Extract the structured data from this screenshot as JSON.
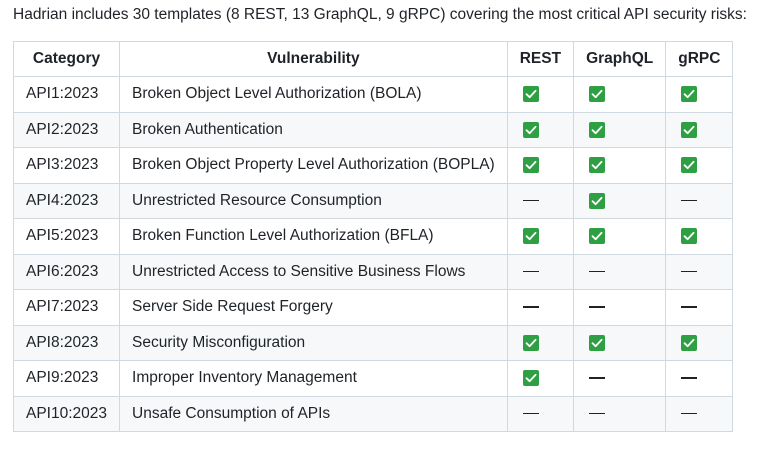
{
  "intro_text": "Hadrian includes 30 templates (8 REST, 13 GraphQL, 9 gRPC) covering the most critical API security risks:",
  "table": {
    "headers": [
      "Category",
      "Vulnerability",
      "REST",
      "GraphQL",
      "gRPC"
    ],
    "rows": [
      {
        "category": "API1:2023",
        "vulnerability": "Broken Object Level Authorization (BOLA)",
        "rest": "check",
        "graphql": "check",
        "grpc": "check"
      },
      {
        "category": "API2:2023",
        "vulnerability": "Broken Authentication",
        "rest": "check",
        "graphql": "check",
        "grpc": "check"
      },
      {
        "category": "API3:2023",
        "vulnerability": "Broken Object Property Level Authorization (BOPLA)",
        "rest": "check",
        "graphql": "check",
        "grpc": "check"
      },
      {
        "category": "API4:2023",
        "vulnerability": "Unrestricted Resource Consumption",
        "rest": "dash",
        "graphql": "check",
        "grpc": "dash"
      },
      {
        "category": "API5:2023",
        "vulnerability": "Broken Function Level Authorization (BFLA)",
        "rest": "check",
        "graphql": "check",
        "grpc": "check"
      },
      {
        "category": "API6:2023",
        "vulnerability": "Unrestricted Access to Sensitive Business Flows",
        "rest": "dash",
        "graphql": "dash",
        "grpc": "dash"
      },
      {
        "category": "API7:2023",
        "vulnerability": "Server Side Request Forgery",
        "rest": "dash",
        "graphql": "dash",
        "grpc": "dash"
      },
      {
        "category": "API8:2023",
        "vulnerability": "Security Misconfiguration",
        "rest": "check",
        "graphql": "check",
        "grpc": "check"
      },
      {
        "category": "API9:2023",
        "vulnerability": "Improper Inventory Management",
        "rest": "check",
        "graphql": "dash",
        "grpc": "dash"
      },
      {
        "category": "API10:2023",
        "vulnerability": "Unsafe Consumption of APIs",
        "rest": "dash",
        "graphql": "dash",
        "grpc": "dash"
      }
    ]
  },
  "colors": {
    "check": "#2ea043",
    "border": "#d1d9e0",
    "stripe": "#f6f8fa"
  }
}
